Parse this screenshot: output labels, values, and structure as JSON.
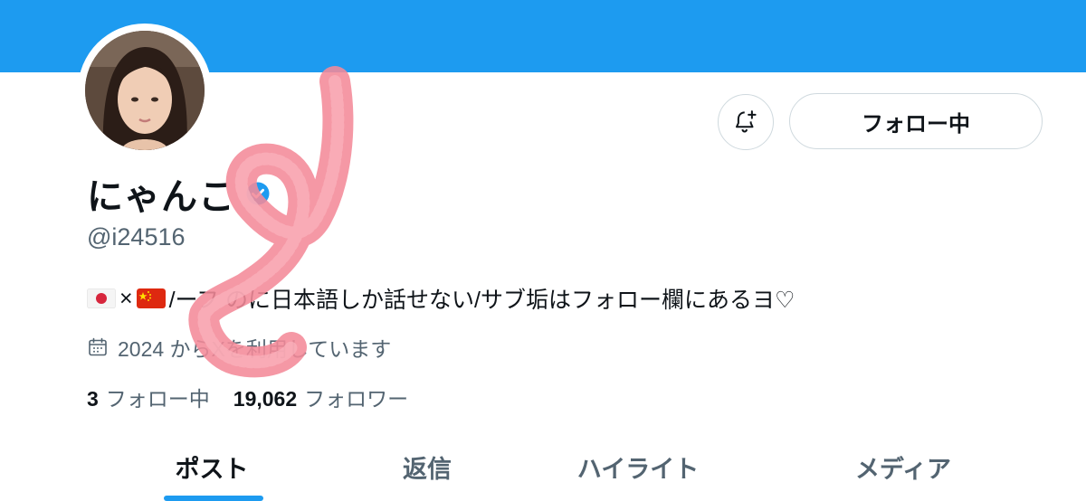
{
  "colors": {
    "banner": "#1d9bf0",
    "accent": "#1d9bf0",
    "text_primary": "#0f1419",
    "text_secondary": "#536471",
    "border": "#cfd9de",
    "scribble": "#f48a98"
  },
  "header": {
    "bell_icon": "notification-bell-plus-icon"
  },
  "profile": {
    "display_name": "にゃんこ",
    "verified_icon": "verified-badge-icon",
    "handle": "@i24516",
    "bio": {
      "flags": [
        "japan-flag-icon",
        "china-flag-icon"
      ],
      "separator": "×",
      "text": "/ーフ   のに日本語しか話せない/サブ垢はフォロー欄にあるヨ♡"
    },
    "joined": {
      "icon": "calendar-icon",
      "text": "2024      からXを利用しています"
    },
    "stats": {
      "following_count": "3",
      "following_label": "フォロー中",
      "followers_count": "19,062",
      "followers_label": "フォロワー"
    }
  },
  "actions": {
    "follow_label": "フォロー中"
  },
  "tabs": [
    {
      "label": "ポスト",
      "active": true
    },
    {
      "label": "返信",
      "active": false
    },
    {
      "label": "ハイライト",
      "active": false
    },
    {
      "label": "メディア",
      "active": false
    }
  ]
}
